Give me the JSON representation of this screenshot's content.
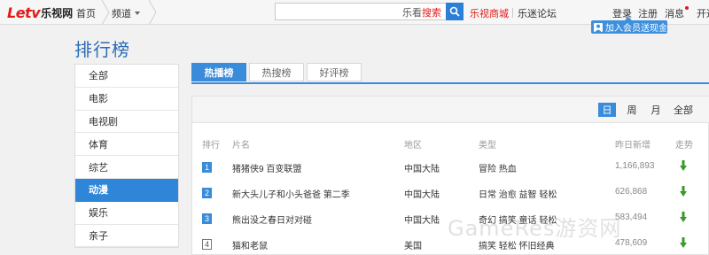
{
  "header": {
    "logo_latin": "Letv",
    "logo_cn": "乐视网",
    "home": "首页",
    "channel": "频道",
    "search": {
      "value": "",
      "hint_prefix": "乐看",
      "hint_brand": "搜索"
    },
    "mall": "乐视商城",
    "forum": "乐迷论坛",
    "login": "登录",
    "register": "注册",
    "messages": "消息",
    "open": "开通",
    "promo": "加入会员送现金"
  },
  "page_title": "排行榜",
  "sidebar": {
    "items": [
      {
        "label": "全部",
        "active": false
      },
      {
        "label": "电影",
        "active": false
      },
      {
        "label": "电视剧",
        "active": false
      },
      {
        "label": "体育",
        "active": false
      },
      {
        "label": "综艺",
        "active": false
      },
      {
        "label": "动漫",
        "active": true
      },
      {
        "label": "娱乐",
        "active": false
      },
      {
        "label": "亲子",
        "active": false
      }
    ]
  },
  "tabs": [
    {
      "label": "热播榜",
      "active": true
    },
    {
      "label": "热搜榜",
      "active": false
    },
    {
      "label": "好评榜",
      "active": false
    }
  ],
  "periods": [
    {
      "label": "日",
      "active": true
    },
    {
      "label": "周",
      "active": false
    },
    {
      "label": "月",
      "active": false
    },
    {
      "label": "全部",
      "active": false
    }
  ],
  "table": {
    "headers": {
      "rank": "排行",
      "title": "片名",
      "region": "地区",
      "genre": "类型",
      "daily": "昨日新增",
      "trend": "走势"
    },
    "rows": [
      {
        "rank": "1",
        "title": "猪猪侠9 百变联盟",
        "region": "中国大陆",
        "genre": "冒险  热血",
        "daily": "1,166,893",
        "trend": "down"
      },
      {
        "rank": "2",
        "title": "新大头儿子和小头爸爸 第二季",
        "region": "中国大陆",
        "genre": "日常  治愈  益智  轻松",
        "daily": "626,868",
        "trend": "down"
      },
      {
        "rank": "3",
        "title": "熊出没之春日对对碰",
        "region": "中国大陆",
        "genre": "奇幻  搞笑  童话  轻松",
        "daily": "583,494",
        "trend": "down"
      },
      {
        "rank": "4",
        "title": "猫和老鼠",
        "region": "美国",
        "genre": "搞笑  轻松  怀旧经典",
        "daily": "478,609",
        "trend": "down"
      }
    ]
  },
  "watermark": "GameRes游资网",
  "colors": {
    "brand_red": "#e31a1a",
    "accent_blue": "#3a8bd9",
    "trend_green": "#3a9a2a"
  }
}
